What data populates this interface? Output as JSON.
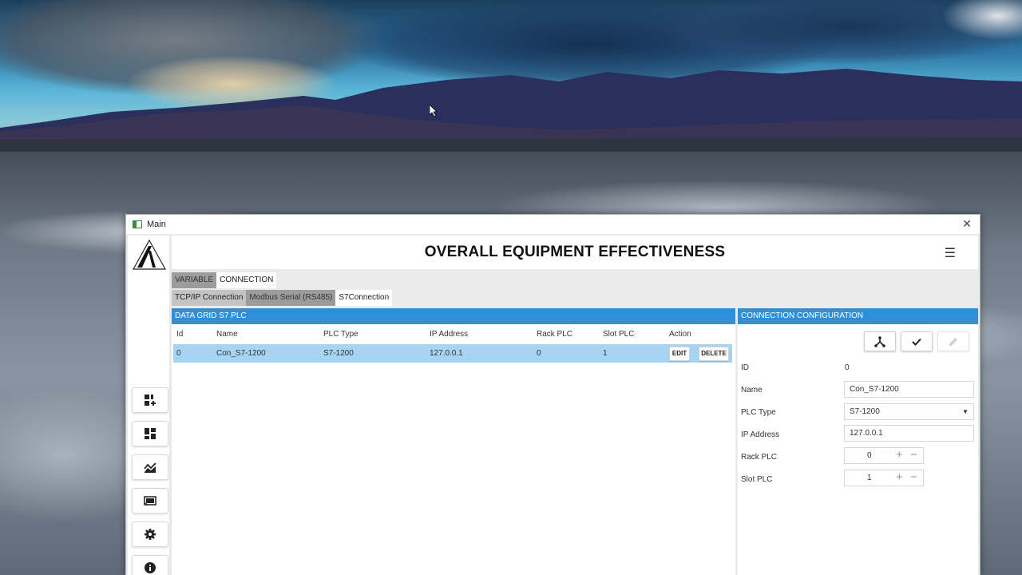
{
  "window": {
    "title": "Main",
    "close_glyph": "✕"
  },
  "header": {
    "title": "OVERALL EQUIPMENT EFFECTIVENESS",
    "menu_glyph": "☰"
  },
  "tabs_main": [
    {
      "label": "VARIABLE",
      "active": false
    },
    {
      "label": "CONNECTION",
      "active": true
    }
  ],
  "tabs_connection": [
    {
      "label": "TCP/IP Connection",
      "active": false
    },
    {
      "label": "Modbus Serial (RS485)",
      "active": false
    },
    {
      "label": "S7Connection",
      "active": true
    }
  ],
  "sidebar": {
    "items": [
      {
        "icon": "dashboard-add-icon",
        "glyph": "▦"
      },
      {
        "icon": "dashboard-icon",
        "glyph": "▦"
      },
      {
        "icon": "chart-icon",
        "glyph": "⛰"
      },
      {
        "icon": "cast-icon",
        "glyph": "▭"
      },
      {
        "icon": "gear-icon",
        "glyph": "⚙"
      },
      {
        "icon": "info-icon",
        "glyph": "ℹ"
      }
    ]
  },
  "grid": {
    "title": "DATA GRID S7 PLC",
    "columns": [
      "Id",
      "Name",
      "PLC Type",
      "IP Address",
      "Rack PLC",
      "Slot PLC",
      "Action"
    ],
    "rows": [
      {
        "id": "0",
        "name": "Con_S7-1200",
        "plc_type": "S7-1200",
        "ip": "127.0.0.1",
        "rack": "0",
        "slot": "1"
      }
    ],
    "edit_label": "EDIT",
    "delete_label": "DELETE"
  },
  "config": {
    "title": "CONNECTION CONFIGURATION",
    "toolbar": {
      "connect_icon": "hub-icon",
      "save_icon": "check-icon",
      "edit_icon": "pencil-icon"
    },
    "fields": {
      "id_label": "ID",
      "id_value": "0",
      "name_label": "Name",
      "name_value": "Con_S7-1200",
      "plc_type_label": "PLC Type",
      "plc_type_value": "S7-1200",
      "ip_label": "IP Address",
      "ip_value": "127.0.0.1",
      "rack_label": "Rack PLC",
      "rack_value": "0",
      "slot_label": "Slot PLC",
      "slot_value": "1"
    },
    "spinner_plus": "+",
    "spinner_minus": "−",
    "dropdown_glyph": "▼"
  },
  "colors": {
    "accent": "#2f8fd8",
    "selected_row": "#a6d4f2",
    "tab_bg": "#c4c4c4"
  }
}
